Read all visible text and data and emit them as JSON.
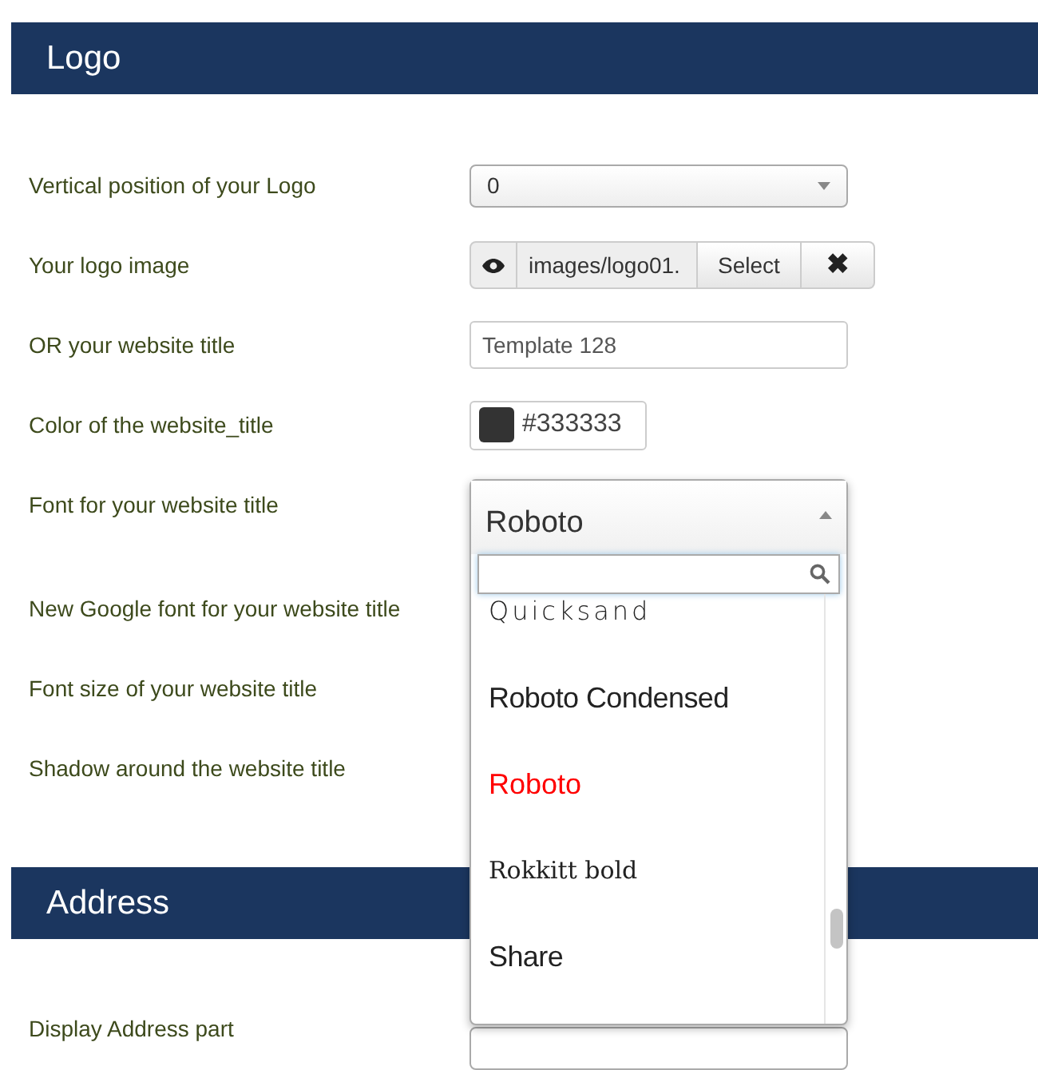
{
  "sections": [
    {
      "title": "Logo",
      "fields": [
        {
          "label": "Vertical position of your Logo",
          "kind": "select",
          "value": "0"
        },
        {
          "label": "Your logo image",
          "kind": "image",
          "value": "images/logo01.",
          "button": "Select",
          "clear": "✖"
        },
        {
          "label": "OR your website title",
          "kind": "text",
          "value": "Template 128"
        },
        {
          "label": "Color of the website_title",
          "kind": "color",
          "value": "#333333",
          "color": "#333333"
        },
        {
          "label": "Font for your website title",
          "kind": "font"
        },
        {
          "label": "New Google font for your website title",
          "kind": "hidden"
        },
        {
          "label": "Font size of your website title",
          "kind": "hidden"
        },
        {
          "label": "Shadow around the website title",
          "kind": "hidden"
        }
      ]
    },
    {
      "title": "Address",
      "fields": [
        {
          "label": "Display Address part",
          "kind": "covered-select"
        }
      ]
    }
  ],
  "font_dropdown": {
    "value": "Roboto",
    "options": [
      {
        "label": "Quicksand",
        "kind": "thin",
        "selected": false
      },
      {
        "label": "Roboto Condensed",
        "kind": "condensed",
        "selected": false
      },
      {
        "label": "Roboto",
        "kind": "sans",
        "selected": true
      },
      {
        "label": "Rokkitt bold",
        "kind": "serif",
        "selected": false
      },
      {
        "label": "Share",
        "kind": "condensed",
        "selected": false
      }
    ]
  }
}
